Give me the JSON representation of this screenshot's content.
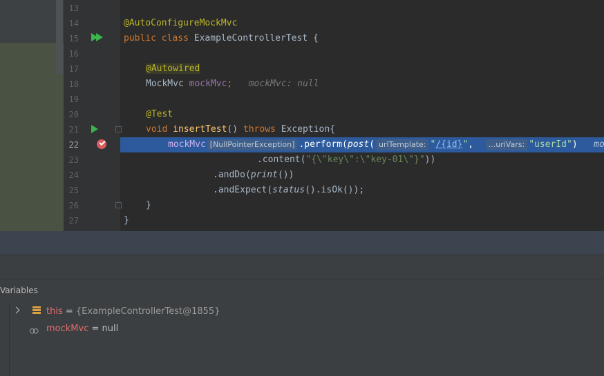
{
  "editor": {
    "lines": [
      {
        "num": "13"
      },
      {
        "num": "14",
        "annotation": "@AutoConfigureMockMvc"
      },
      {
        "num": "15",
        "kw1": "public",
        "kw2": "class",
        "name": "ExampleControllerTest",
        "brace": "{"
      },
      {
        "num": "16"
      },
      {
        "num": "17",
        "annotation": "@Autowired"
      },
      {
        "num": "18",
        "type": "MockMvc",
        "field": "mockMvc",
        "semi": ";",
        "inline_value": "mockMvc: null"
      },
      {
        "num": "19"
      },
      {
        "num": "20",
        "annotation": "@Test"
      },
      {
        "num": "21",
        "kw1": "void",
        "method": "insertTest",
        "parens": "()",
        "kw2": "throws",
        "exc": "Exception{"
      },
      {
        "num": "22",
        "field": "mockMvc",
        "hint_exc": "[NullPointerException]",
        "perform": ".perform(",
        "post": "post",
        "open": "(",
        "hint_tpl": "urlTemplate:",
        "str_q1": "\"",
        "url": "/{id}",
        "str_q2": "\"",
        "comma": ",",
        "hint_vars": "...uriVars:",
        "arg": "\"userId\"",
        "close": ")",
        "overflow": "moc"
      },
      {
        "num": "23",
        "content_prefix": ".content(",
        "content_str": "\"{\\\"key\\\":\\\"key-01\\\"}\"",
        "content_close": "))"
      },
      {
        "num": "24",
        "do_prefix": ".andDo(",
        "print": "print",
        "do_close": "())"
      },
      {
        "num": "25",
        "exp_prefix": ".andExpect(",
        "status": "status",
        "exp_close": "().isOk());"
      },
      {
        "num": "26",
        "brace": "}"
      },
      {
        "num": "27",
        "brace": "}"
      }
    ]
  },
  "variables": {
    "title": "Variables",
    "rows": [
      {
        "name": "this",
        "eq": " = ",
        "value": "{ExampleControllerTest@1855}",
        "icon": "object-stack-icon"
      },
      {
        "name": "mockMvc",
        "eq": " = ",
        "value": "null",
        "icon": "watch-glasses-icon"
      }
    ]
  },
  "colors": {
    "keyword": "#cc7832",
    "annotation": "#bbb529",
    "field": "#9876aa",
    "method": "#ffc66d",
    "string": "#6a8759",
    "selection": "#2d5a9c",
    "breakpoint": "#db5c5c",
    "run": "#3bb54a"
  }
}
